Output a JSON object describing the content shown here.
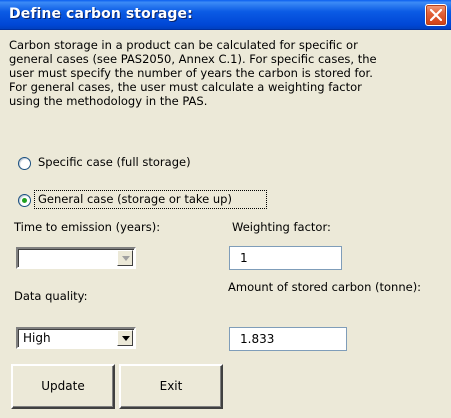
{
  "window": {
    "title": "Define carbon storage:"
  },
  "description": {
    "lines": [
      "Carbon storage in a product can be calculated for specific or",
      "general cases (see PAS2050, Annex C.1). For specific cases, the",
      "user must specify the number of years the carbon is stored for.",
      "For general cases, the user must calculate a weighting factor",
      "using the methodology in the PAS."
    ]
  },
  "options": {
    "specific_label": "Specific case (full storage)",
    "general_label": "General case (storage or take up)",
    "selected": "general"
  },
  "fields": {
    "time_label": "Time to emission (years):",
    "time_value": "",
    "weighting_label": "Weighting factor:",
    "weighting_value": "1",
    "quality_label": "Data quality:",
    "quality_value": "High",
    "amount_label": "Amount of stored carbon (tonne):",
    "amount_value": "1.833"
  },
  "buttons": {
    "update_label": "Update",
    "exit_label": "Exit"
  },
  "icons": {
    "close": "close-icon",
    "dropdown": "chevron-down-icon"
  },
  "colors": {
    "titlebar": "#0054e3",
    "close": "#d8512b",
    "radio_dot": "#21a121",
    "dialog_bg": "#ece9d8"
  }
}
